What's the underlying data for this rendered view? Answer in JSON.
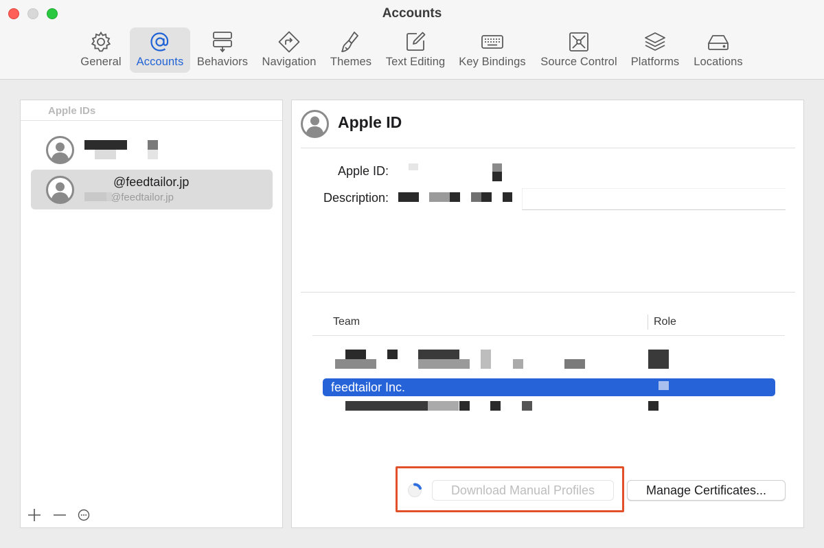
{
  "window": {
    "title": "Accounts"
  },
  "toolbar": {
    "tabs": [
      {
        "label": "General",
        "icon": "gear-icon"
      },
      {
        "label": "Accounts",
        "icon": "at-sign-icon"
      },
      {
        "label": "Behaviors",
        "icon": "behaviors-icon"
      },
      {
        "label": "Navigation",
        "icon": "navigation-icon"
      },
      {
        "label": "Themes",
        "icon": "paintbrush-icon"
      },
      {
        "label": "Text Editing",
        "icon": "pencil-square-icon"
      },
      {
        "label": "Key Bindings",
        "icon": "keyboard-icon"
      },
      {
        "label": "Source Control",
        "icon": "source-control-icon"
      },
      {
        "label": "Platforms",
        "icon": "layers-icon"
      },
      {
        "label": "Locations",
        "icon": "disk-icon"
      }
    ],
    "active_tab": "Accounts"
  },
  "sidebar": {
    "header": "Apple IDs",
    "accounts": [
      {
        "name": "",
        "subtitle": ""
      },
      {
        "name": "@feedtailor.jp",
        "subtitle": "@feedtailor.jp"
      }
    ]
  },
  "detail": {
    "title": "Apple ID",
    "apple_id_label": "Apple ID:",
    "description_label": "Description:",
    "description_value": "",
    "table": {
      "columns": [
        "Team",
        "Role"
      ],
      "selected_team": "feedtailor Inc."
    },
    "buttons": {
      "download_profiles": "Download Manual Profiles",
      "manage_certificates": "Manage Certificates..."
    }
  },
  "colors": {
    "accent": "#1f63d6",
    "selection": "#2663d9",
    "highlight_box": "#e2502a"
  }
}
